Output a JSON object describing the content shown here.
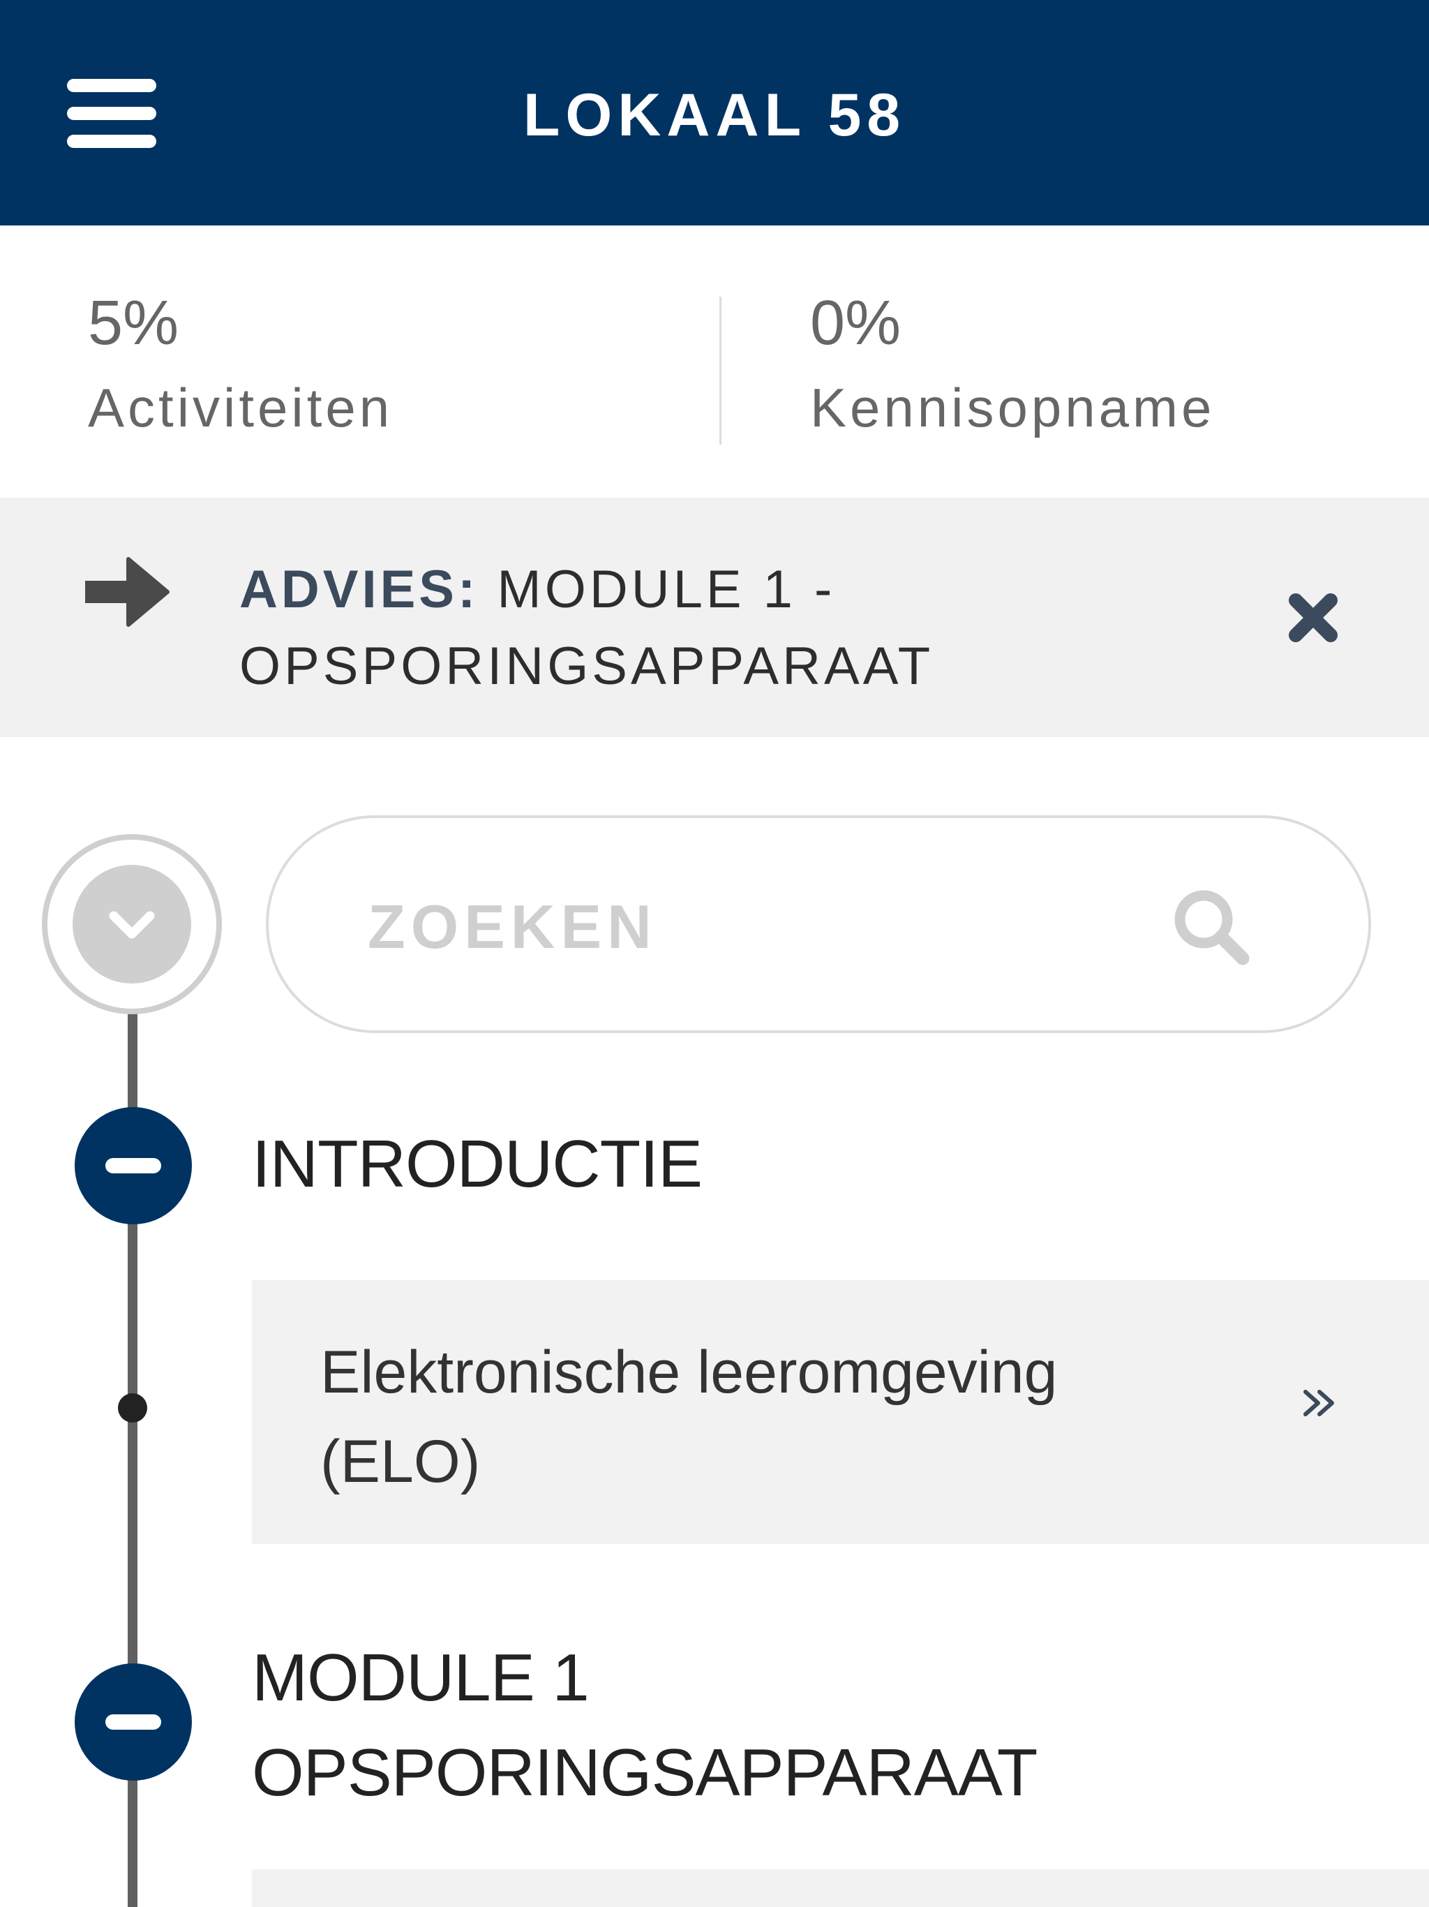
{
  "header": {
    "title": "LOKAAL 58",
    "menu_icon": "hamburger-menu-icon"
  },
  "stats": [
    {
      "value": "5%",
      "label": "Activiteiten"
    },
    {
      "value": "0%",
      "label": "Kennisopname"
    }
  ],
  "advice": {
    "prefix": "ADVIES:",
    "text": "MODULE 1 - OPSPORINGSAPPARAAT",
    "arrow_icon": "arrow-right-icon",
    "close_icon": "close-icon"
  },
  "search": {
    "placeholder": "ZOEKEN",
    "value": "",
    "icon": "search-icon"
  },
  "timeline": {
    "toggle_icon": "chevron-down-icon",
    "sections": [
      {
        "title": "INTRODUCTIE",
        "collapse_icon": "minus-icon",
        "items": [
          {
            "label": "Elektronische leeromgeving (ELO)",
            "icon": "double-chevron-right-icon"
          }
        ]
      },
      {
        "title": "MODULE 1 OPSPORINGSAPPARAAT",
        "collapse_icon": "minus-icon",
        "items": []
      }
    ]
  },
  "colors": {
    "primary": "#003361",
    "panel_background": "#f1f1f1",
    "muted_text": "#666666",
    "border": "#dcdcdc"
  }
}
